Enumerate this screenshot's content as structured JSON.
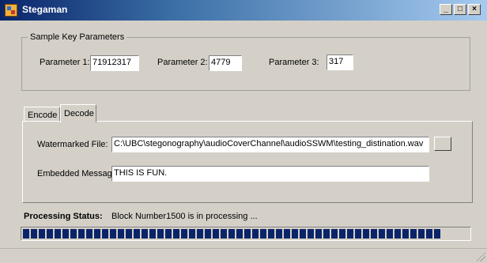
{
  "window": {
    "title": "Stegaman",
    "minimize_glyph": "_",
    "maximize_glyph": "□",
    "close_glyph": "×"
  },
  "key_params": {
    "legend": "Sample Key Parameters",
    "param1_label": "Parameter 1:",
    "param1_value": "71912317",
    "param2_label": "Parameter 2:",
    "param2_value": "4779",
    "param3_label": "Parameter 3:",
    "param3_value": "317"
  },
  "tabs": {
    "encode": "Encode",
    "decode": "Decode",
    "active": "Decode"
  },
  "decode": {
    "watermarked_label": "Watermarked File:",
    "watermarked_value": "C:\\UBC\\stegonography\\audioCoverChannel\\audioSSWM\\testing_distination.wav",
    "message_label": "Embedded Message:",
    "message_value": "THIS IS FUN."
  },
  "status": {
    "label": "Processing Status:",
    "value": "Block Number1500 is in processing ...",
    "progress_fraction": 0.94
  },
  "colors": {
    "title_start": "#0a246a",
    "title_end": "#a6caf0",
    "progress": "#0a246a",
    "face": "#d4d0c8"
  }
}
